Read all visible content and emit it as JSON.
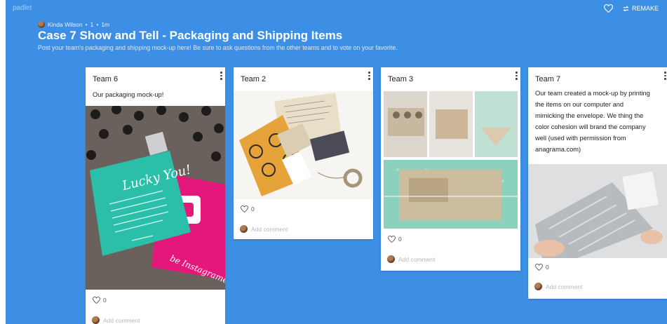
{
  "header": {
    "brand": "padlet",
    "remake_label": "REMAKE",
    "author": "Kinda Wilson",
    "separator1": "•",
    "count": "1",
    "separator2": "•",
    "time": "1m",
    "title": "Case 7 Show and Tell - Packaging and Shipping Items",
    "subtitle": "Post your team's packaging and shipping mock-up here! Be sure to ask questions from the other teams and to vote on your favorite."
  },
  "icons": {
    "heart": "heart-icon",
    "remake": "remake-icon",
    "menu": "more-vertical-icon",
    "avatar": "avatar"
  },
  "colors": {
    "background": "#3d8fe6",
    "card": "#ffffff"
  },
  "cards": [
    {
      "title": "Team 6",
      "text": "Our packaging mock-up!",
      "likes": "0",
      "comment_placeholder": "Add comment",
      "photo_text": "Lucky You!",
      "photo_caption": "be Instagramed"
    },
    {
      "title": "Team 2",
      "text": "",
      "likes": "0",
      "comment_placeholder": "Add comment"
    },
    {
      "title": "Team 3",
      "text": "",
      "likes": "0",
      "comment_placeholder": "Add comment"
    },
    {
      "title": "Team 7",
      "text_lines": [
        "Our team created a mock-up by printing",
        "the items on our computer and",
        "mimicking the envelope. We thing the",
        "color cohesion will brand the company",
        "well (used with permission from",
        "anagrama.com)"
      ],
      "likes": "0",
      "comment_placeholder": "Add comment"
    }
  ]
}
